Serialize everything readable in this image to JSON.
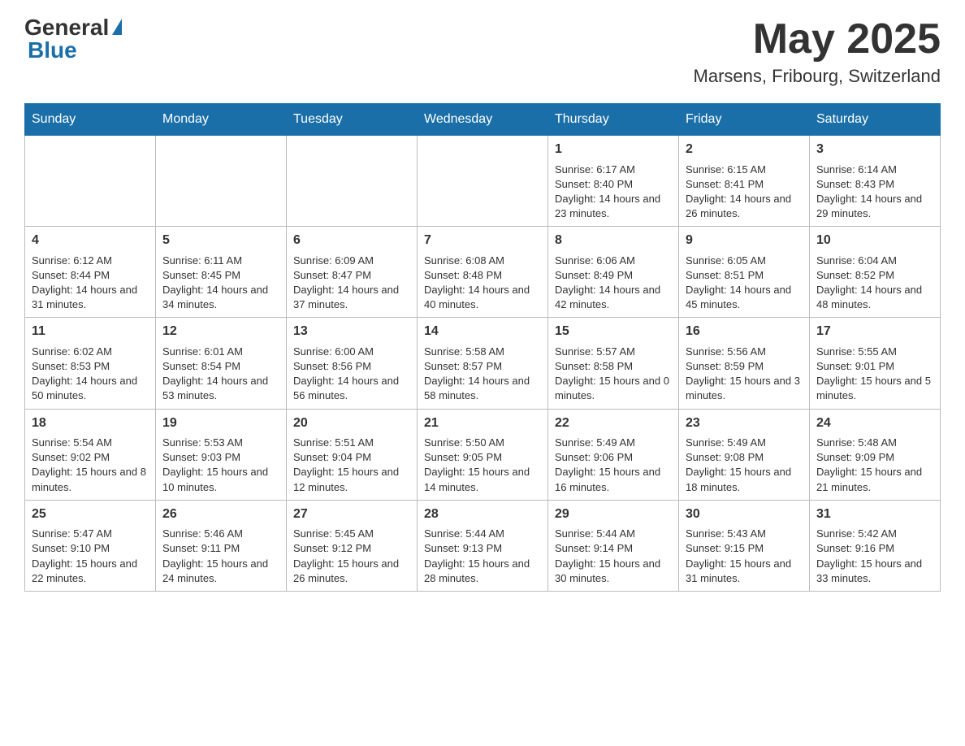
{
  "header": {
    "logo_general": "General",
    "logo_blue": "Blue",
    "month_year": "May 2025",
    "location": "Marsens, Fribourg, Switzerland"
  },
  "days_of_week": [
    "Sunday",
    "Monday",
    "Tuesday",
    "Wednesday",
    "Thursday",
    "Friday",
    "Saturday"
  ],
  "weeks": [
    [
      {
        "day": "",
        "info": ""
      },
      {
        "day": "",
        "info": ""
      },
      {
        "day": "",
        "info": ""
      },
      {
        "day": "",
        "info": ""
      },
      {
        "day": "1",
        "info": "Sunrise: 6:17 AM\nSunset: 8:40 PM\nDaylight: 14 hours and 23 minutes."
      },
      {
        "day": "2",
        "info": "Sunrise: 6:15 AM\nSunset: 8:41 PM\nDaylight: 14 hours and 26 minutes."
      },
      {
        "day": "3",
        "info": "Sunrise: 6:14 AM\nSunset: 8:43 PM\nDaylight: 14 hours and 29 minutes."
      }
    ],
    [
      {
        "day": "4",
        "info": "Sunrise: 6:12 AM\nSunset: 8:44 PM\nDaylight: 14 hours and 31 minutes."
      },
      {
        "day": "5",
        "info": "Sunrise: 6:11 AM\nSunset: 8:45 PM\nDaylight: 14 hours and 34 minutes."
      },
      {
        "day": "6",
        "info": "Sunrise: 6:09 AM\nSunset: 8:47 PM\nDaylight: 14 hours and 37 minutes."
      },
      {
        "day": "7",
        "info": "Sunrise: 6:08 AM\nSunset: 8:48 PM\nDaylight: 14 hours and 40 minutes."
      },
      {
        "day": "8",
        "info": "Sunrise: 6:06 AM\nSunset: 8:49 PM\nDaylight: 14 hours and 42 minutes."
      },
      {
        "day": "9",
        "info": "Sunrise: 6:05 AM\nSunset: 8:51 PM\nDaylight: 14 hours and 45 minutes."
      },
      {
        "day": "10",
        "info": "Sunrise: 6:04 AM\nSunset: 8:52 PM\nDaylight: 14 hours and 48 minutes."
      }
    ],
    [
      {
        "day": "11",
        "info": "Sunrise: 6:02 AM\nSunset: 8:53 PM\nDaylight: 14 hours and 50 minutes."
      },
      {
        "day": "12",
        "info": "Sunrise: 6:01 AM\nSunset: 8:54 PM\nDaylight: 14 hours and 53 minutes."
      },
      {
        "day": "13",
        "info": "Sunrise: 6:00 AM\nSunset: 8:56 PM\nDaylight: 14 hours and 56 minutes."
      },
      {
        "day": "14",
        "info": "Sunrise: 5:58 AM\nSunset: 8:57 PM\nDaylight: 14 hours and 58 minutes."
      },
      {
        "day": "15",
        "info": "Sunrise: 5:57 AM\nSunset: 8:58 PM\nDaylight: 15 hours and 0 minutes."
      },
      {
        "day": "16",
        "info": "Sunrise: 5:56 AM\nSunset: 8:59 PM\nDaylight: 15 hours and 3 minutes."
      },
      {
        "day": "17",
        "info": "Sunrise: 5:55 AM\nSunset: 9:01 PM\nDaylight: 15 hours and 5 minutes."
      }
    ],
    [
      {
        "day": "18",
        "info": "Sunrise: 5:54 AM\nSunset: 9:02 PM\nDaylight: 15 hours and 8 minutes."
      },
      {
        "day": "19",
        "info": "Sunrise: 5:53 AM\nSunset: 9:03 PM\nDaylight: 15 hours and 10 minutes."
      },
      {
        "day": "20",
        "info": "Sunrise: 5:51 AM\nSunset: 9:04 PM\nDaylight: 15 hours and 12 minutes."
      },
      {
        "day": "21",
        "info": "Sunrise: 5:50 AM\nSunset: 9:05 PM\nDaylight: 15 hours and 14 minutes."
      },
      {
        "day": "22",
        "info": "Sunrise: 5:49 AM\nSunset: 9:06 PM\nDaylight: 15 hours and 16 minutes."
      },
      {
        "day": "23",
        "info": "Sunrise: 5:49 AM\nSunset: 9:08 PM\nDaylight: 15 hours and 18 minutes."
      },
      {
        "day": "24",
        "info": "Sunrise: 5:48 AM\nSunset: 9:09 PM\nDaylight: 15 hours and 21 minutes."
      }
    ],
    [
      {
        "day": "25",
        "info": "Sunrise: 5:47 AM\nSunset: 9:10 PM\nDaylight: 15 hours and 22 minutes."
      },
      {
        "day": "26",
        "info": "Sunrise: 5:46 AM\nSunset: 9:11 PM\nDaylight: 15 hours and 24 minutes."
      },
      {
        "day": "27",
        "info": "Sunrise: 5:45 AM\nSunset: 9:12 PM\nDaylight: 15 hours and 26 minutes."
      },
      {
        "day": "28",
        "info": "Sunrise: 5:44 AM\nSunset: 9:13 PM\nDaylight: 15 hours and 28 minutes."
      },
      {
        "day": "29",
        "info": "Sunrise: 5:44 AM\nSunset: 9:14 PM\nDaylight: 15 hours and 30 minutes."
      },
      {
        "day": "30",
        "info": "Sunrise: 5:43 AM\nSunset: 9:15 PM\nDaylight: 15 hours and 31 minutes."
      },
      {
        "day": "31",
        "info": "Sunrise: 5:42 AM\nSunset: 9:16 PM\nDaylight: 15 hours and 33 minutes."
      }
    ]
  ]
}
